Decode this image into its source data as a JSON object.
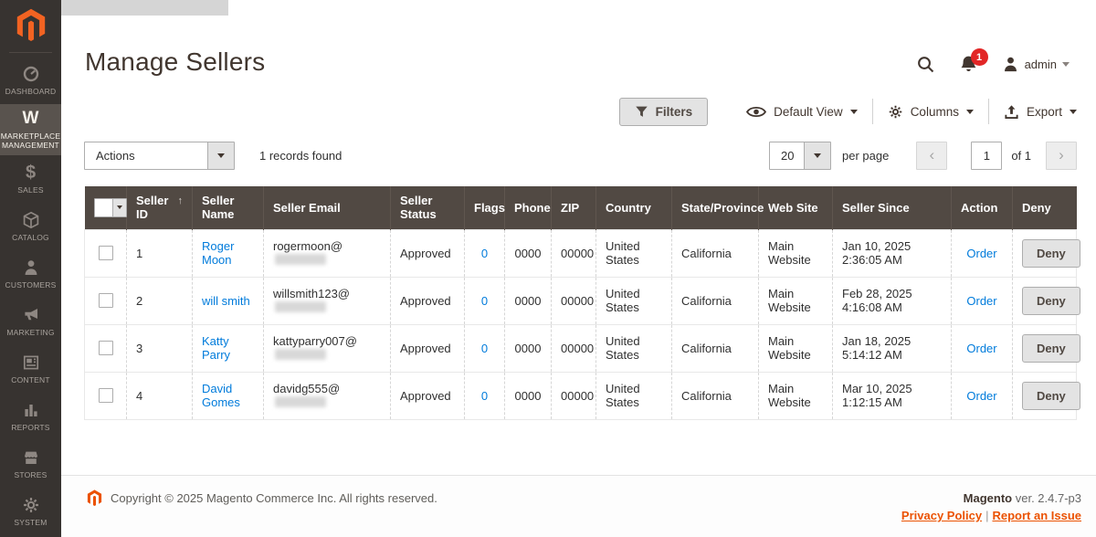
{
  "colors": {
    "accent_orange": "#eb5202",
    "logo_orange": "#f26322",
    "link_blue": "#007bdb",
    "table_header_bg": "#514943",
    "sidebar_bg": "#373330",
    "sidebar_active_bg": "#59534e",
    "badge_red": "#e22626"
  },
  "icons": {
    "sort_asc": "↑",
    "prev_chevron": "‹",
    "next_chevron": "›"
  },
  "sidebar": {
    "items": [
      {
        "label": "DASHBOARD"
      },
      {
        "label": "MARKETPLACE MANAGEMENT"
      },
      {
        "label": "SALES"
      },
      {
        "label": "CATALOG"
      },
      {
        "label": "CUSTOMERS"
      },
      {
        "label": "MARKETING"
      },
      {
        "label": "CONTENT"
      },
      {
        "label": "REPORTS"
      },
      {
        "label": "STORES"
      },
      {
        "label": "SYSTEM"
      }
    ]
  },
  "header": {
    "title": "Manage Sellers",
    "notification_count": "1",
    "user_name": "admin"
  },
  "toolbar": {
    "filters": "Filters",
    "default_view": "Default View",
    "columns": "Columns",
    "export": "Export"
  },
  "controls": {
    "actions": "Actions",
    "records_found": "1 records found",
    "per_page_value": "20",
    "per_page_label": "per page",
    "page_value": "1",
    "page_of": "of 1"
  },
  "table": {
    "columns": [
      "Seller ID",
      "Seller Name",
      "Seller Email",
      "Seller Status",
      "Flags",
      "Phone",
      "ZIP",
      "Country",
      "State/Province",
      "Web Site",
      "Seller Since",
      "Action",
      "Deny"
    ],
    "rows": [
      {
        "id": "1",
        "name": "Roger Moon",
        "email_user": "rogermoon@",
        "status": "Approved",
        "flags": "0",
        "phone": "0000",
        "zip": "00000",
        "country": "United States",
        "state": "California",
        "website": "Main Website",
        "since": "Jan 10, 2025 2:36:05 AM",
        "action": "Order",
        "deny": "Deny"
      },
      {
        "id": "2",
        "name": "will smith",
        "email_user": "willsmith123@",
        "status": "Approved",
        "flags": "0",
        "phone": "0000",
        "zip": "00000",
        "country": "United States",
        "state": "California",
        "website": "Main Website",
        "since": "Feb 28, 2025 4:16:08 AM",
        "action": "Order",
        "deny": "Deny"
      },
      {
        "id": "3",
        "name": "Katty Parry",
        "email_user": "kattyparry007@",
        "status": "Approved",
        "flags": "0",
        "phone": "0000",
        "zip": "00000",
        "country": "United States",
        "state": "California",
        "website": "Main Website",
        "since": "Jan 18, 2025 5:14:12 AM",
        "action": "Order",
        "deny": "Deny"
      },
      {
        "id": "4",
        "name": "David Gomes",
        "email_user": "davidg555@",
        "status": "Approved",
        "flags": "0",
        "phone": "0000",
        "zip": "00000",
        "country": "United States",
        "state": "California",
        "website": "Main Website",
        "since": "Mar 10, 2025 1:12:15 AM",
        "action": "Order",
        "deny": "Deny"
      }
    ]
  },
  "footer": {
    "copyright": "Copyright © 2025 Magento Commerce Inc. All rights reserved.",
    "brand": "Magento",
    "version": " ver. 2.4.7-p3",
    "privacy_policy": "Privacy Policy",
    "separator": "|",
    "report_issue": "Report an Issue"
  }
}
